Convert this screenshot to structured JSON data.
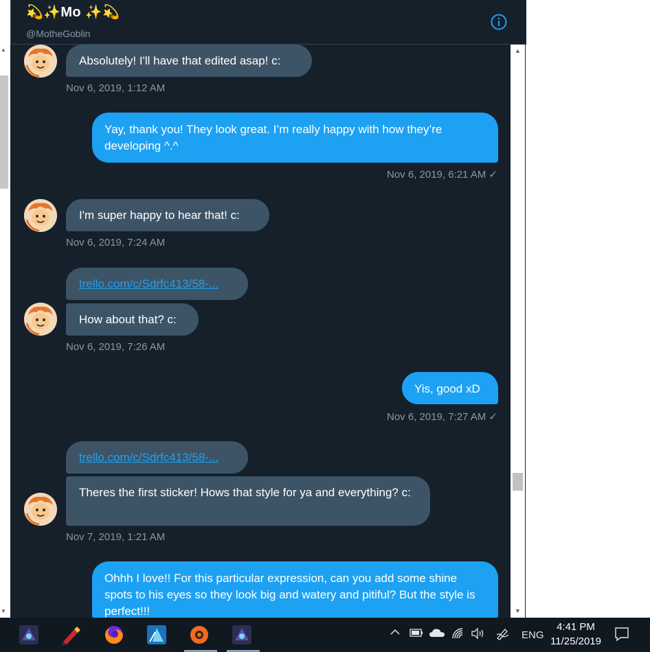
{
  "header": {
    "name": "💫✨Mo ✨💫",
    "handle": "@MotheGoblin"
  },
  "messages": [
    {
      "text": "Absolutely! I'll have that edited asap! c:",
      "time": "Nov 6, 2019, 1:12 AM"
    },
    {
      "text": "Yay, thank you! They look great. I’m really happy with how they’re developing ^.^",
      "time": "Nov 6, 2019, 6:21 AM",
      "check": "✓"
    },
    {
      "text": "I'm super happy to hear that! c:",
      "time": "Nov 6, 2019, 7:24 AM"
    },
    {
      "link": "trello.com/c/Sdrfc413/58-...",
      "text": "How about that? c:",
      "time": "Nov 6, 2019, 7:26 AM"
    },
    {
      "text": "Yis, good xD",
      "time": "Nov 6, 2019, 7:27 AM",
      "check": "✓"
    },
    {
      "link": "trello.com/c/Sdrfc413/58-...",
      "text": "Theres the first sticker! Hows that style for ya and everything? c:",
      "time": "Nov 7, 2019, 1:21 AM"
    },
    {
      "text": "Ohhh I love!! For this particular expression, can you add some shine spots to his eyes so they look big and watery and pitiful? But the style is perfect!!!"
    }
  ],
  "taskbar": {
    "lang": "ENG",
    "time": "4:41 PM",
    "date": "11/25/2019",
    "apps": [
      "affinity-photo-icon",
      "pencil-app-icon",
      "firefox-icon",
      "affinity-designer-icon",
      "orange-app-icon",
      "affinity-photo-icon"
    ]
  },
  "colors": {
    "accent": "#1da1f2",
    "background": "#15202b",
    "incoming": "#3d5466"
  }
}
